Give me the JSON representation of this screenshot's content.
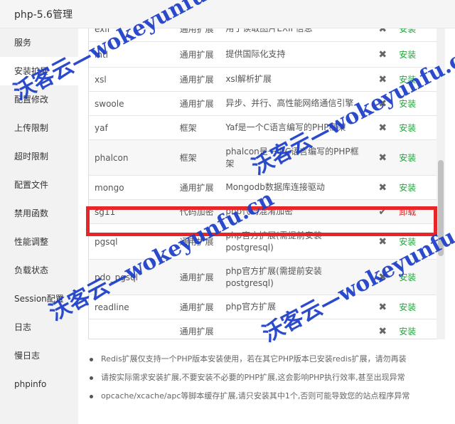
{
  "window": {
    "title": "php-5.6管理"
  },
  "sidebar": {
    "items": [
      {
        "label": "服务"
      },
      {
        "label": "安装扩展"
      },
      {
        "label": "配置修改"
      },
      {
        "label": "上传限制"
      },
      {
        "label": "超时限制"
      },
      {
        "label": "配置文件"
      },
      {
        "label": "禁用函数"
      },
      {
        "label": "性能调整"
      },
      {
        "label": "负载状态"
      },
      {
        "label": "Session配置"
      },
      {
        "label": "日志"
      },
      {
        "label": "慢日志"
      },
      {
        "label": "phpinfo"
      }
    ],
    "active_index": 1
  },
  "extensions": {
    "rows": [
      {
        "name": "exif",
        "type": "通用扩展",
        "desc": "用于读取图片EXIF信息",
        "installed": false,
        "action": "安装"
      },
      {
        "name": "intl",
        "type": "通用扩展",
        "desc": "提供国际化支持",
        "installed": false,
        "action": "安装"
      },
      {
        "name": "xsl",
        "type": "通用扩展",
        "desc": "xsl解析扩展",
        "installed": false,
        "action": "安装"
      },
      {
        "name": "swoole",
        "type": "通用扩展",
        "desc": "异步、并行、高性能网络通信引擎",
        "installed": false,
        "action": "安装"
      },
      {
        "name": "yaf",
        "type": "框架",
        "desc": "Yaf是一个C语言编写的PHP框架",
        "installed": false,
        "action": "安装"
      },
      {
        "name": "phalcon",
        "type": "框架",
        "desc": "phalcon是一个C语言编写的PHP框架",
        "installed": false,
        "action": "安装"
      },
      {
        "name": "mongo",
        "type": "通用扩展",
        "desc": "Mongodb数据库连接驱动",
        "installed": false,
        "action": "安装"
      },
      {
        "name": "sg11",
        "type": "代码加密",
        "desc": "php代码混淆加密",
        "installed": true,
        "action": "卸载"
      },
      {
        "name": "pgsql",
        "type": "通用扩展",
        "desc": "php官方扩展(需提前安装postgresql)",
        "installed": false,
        "action": "安装"
      },
      {
        "name": "pdo_pgsql",
        "type": "通用扩展",
        "desc": "php官方扩展(需提前安装postgresql)",
        "installed": false,
        "action": "安装"
      },
      {
        "name": "readline",
        "type": "通用扩展",
        "desc": "php官方扩展",
        "installed": false,
        "action": "安装"
      },
      {
        "name": "",
        "type": "通用扩展",
        "desc": "",
        "installed": false,
        "action": "安装"
      }
    ],
    "status_icons": {
      "installed": "check-icon",
      "not_installed": "cross-icon"
    },
    "colors": {
      "install": "#20a53a",
      "uninstall": "#e02020",
      "highlight": "#e8262a"
    }
  },
  "notes": [
    "Redis扩展仅支持一个PHP版本安装使用，若在其它PHP版本已安装redis扩展，请勿再装",
    "请按实际需求安装扩展,不要安装不必要的PHP扩展,这会影响PHP执行效率,甚至出现异常",
    "opcache/xcache/apc等脚本缓存扩展,请只安装其中1个,否则可能导致您的站点程序异常"
  ],
  "watermark": {
    "text": "沃客云—wokeyunfu.cn",
    "color": "#1a3cc8"
  }
}
